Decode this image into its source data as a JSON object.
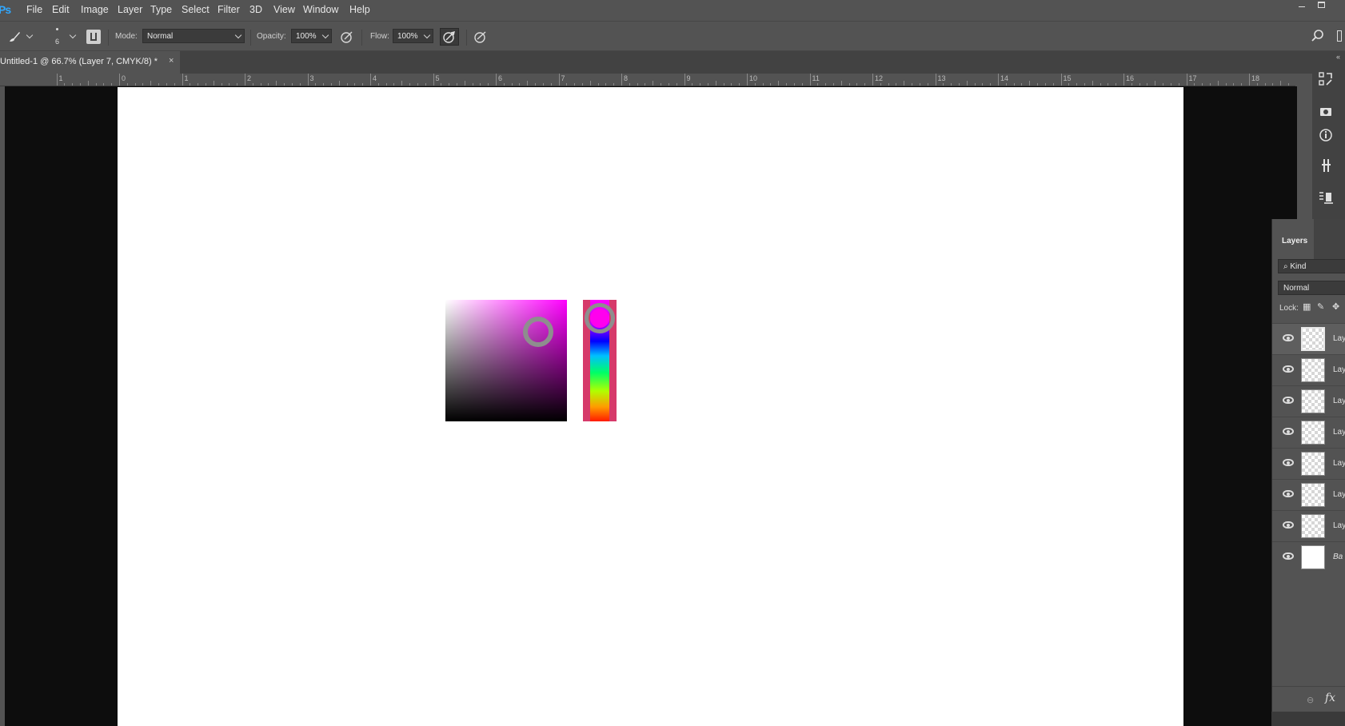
{
  "app": {
    "logo": "Ps"
  },
  "menu": [
    "File",
    "Edit",
    "Image",
    "Layer",
    "Type",
    "Select",
    "Filter",
    "3D",
    "View",
    "Window",
    "Help"
  ],
  "options": {
    "brush_size": "6",
    "mode_label": "Mode:",
    "mode_value": "Normal",
    "opacity_label": "Opacity:",
    "opacity_value": "100%",
    "flow_label": "Flow:",
    "flow_value": "100%"
  },
  "document_tab": {
    "title": "Untitled-1 @ 66.7% (Layer 7, CMYK/8) *",
    "close": "×"
  },
  "ruler": {
    "labels": [
      "1",
      "0",
      "1",
      "2",
      "3",
      "4",
      "5",
      "6",
      "7",
      "8",
      "9",
      "10",
      "11",
      "12",
      "13",
      "14",
      "15",
      "16",
      "17",
      "18"
    ]
  },
  "color_picker": {
    "selected_color": "#ff00ff",
    "hue_color": "#ff00ee",
    "frame_color": "#d63a6a"
  },
  "layers_panel": {
    "title": "Layers",
    "filter_kind": "Kind",
    "blend_mode": "Normal",
    "lock_label": "Lock:",
    "layers": [
      {
        "name": "Lay",
        "selected": true,
        "thumb": "transparent"
      },
      {
        "name": "Lay",
        "selected": false,
        "thumb": "transparent"
      },
      {
        "name": "Lay",
        "selected": false,
        "thumb": "transparent"
      },
      {
        "name": "Lay",
        "selected": false,
        "thumb": "transparent"
      },
      {
        "name": "Lay",
        "selected": false,
        "thumb": "transparent"
      },
      {
        "name": "Lay",
        "selected": false,
        "thumb": "transparent"
      },
      {
        "name": "Lay",
        "selected": false,
        "thumb": "transparent"
      },
      {
        "name": "Ba",
        "selected": false,
        "thumb": "white"
      }
    ],
    "footer_fx": "fx"
  },
  "icons": [
    "brush-tool-icon",
    "brush-preset-icon",
    "toggle-brush-panel-icon",
    "airbrush-icon",
    "pressure-opacity-icon",
    "pressure-size-icon",
    "search-icon",
    "history-icon",
    "properties-icon",
    "info-icon",
    "tool-presets-icon",
    "paragraph-icon",
    "visibility-icon",
    "link-layers-icon",
    "layer-style-icon"
  ]
}
